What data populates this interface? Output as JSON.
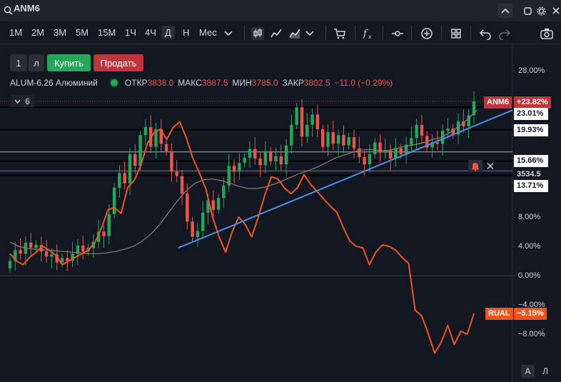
{
  "search": {
    "ticker": "ANM6"
  },
  "toolbar": {
    "timeframes": [
      "1M",
      "2M",
      "3M",
      "5M",
      "15M",
      "1Ч",
      "4Ч",
      "Д",
      "Н",
      "Мес"
    ],
    "active_timeframe": "Д"
  },
  "trade": {
    "qty": "1",
    "lot": "л",
    "buy_label": "Купить",
    "sell_label": "Продать"
  },
  "instrument": {
    "name": "ALUM-6.26 Алюминий",
    "open_label": "ОТКР",
    "open": "3838.0",
    "high_label": "МАКС",
    "high": "3887.5",
    "low_label": "МИН",
    "low": "3785.0",
    "close_label": "ЗАКР",
    "close": "3802.5",
    "change": "−11.0 (−0.29%)"
  },
  "indicator_count": "6",
  "price_tags": {
    "anm6_name": "ANM6",
    "anm6_pct": "+23.82%",
    "rual_name": "RUAL",
    "rual_pct": "−5.15%",
    "current_price": "3534.5"
  },
  "level_tags": [
    "23.01%",
    "19.93%",
    "15.66%",
    "13.71%"
  ],
  "scale_buttons": {
    "auto": "A",
    "log": "Л"
  },
  "colors": {
    "up": "#26a65b",
    "down": "#ef5350",
    "compare": "#f0541e",
    "trendline": "#4a8fe8",
    "ma": "#8b8270"
  },
  "chart_data": {
    "type": "line",
    "yaxis": {
      "unit": "%",
      "ticks": [
        28,
        24,
        20,
        16,
        12,
        8,
        4,
        0,
        -4,
        -8
      ],
      "labels": [
        "28.00%",
        "",
        "",
        "",
        "",
        "8.00%",
        "4.00%",
        "0.00%",
        "−4.00%",
        "−8.00%"
      ],
      "ylim": [
        -10.5,
        30
      ]
    },
    "levels": [
      23.01,
      19.93,
      15.66,
      13.71
    ],
    "series": [
      {
        "name": "ANM6",
        "type": "candles",
        "last": 23.82,
        "closes": [
          2,
          3.5,
          3,
          4.5,
          3.8,
          4.2,
          3.3,
          2.6,
          2.9,
          1.8,
          2.4,
          2.0,
          3.0,
          4.1,
          3.3,
          3.8,
          4.6,
          6.0,
          5.4,
          8.4,
          12.0,
          14.0,
          12.6,
          16.6,
          15.0,
          19.2,
          20.3,
          17.6,
          20.0,
          18.0,
          17.0,
          14.2,
          13.6,
          11.2,
          7.4,
          5.3,
          6.1,
          8.6,
          10.3,
          9.0,
          10.6,
          12.3,
          15.0,
          14.2,
          15.4,
          16.1,
          17.3,
          16.0,
          15.1,
          17.0,
          15.6,
          16.3,
          15.2,
          17.8,
          20.6,
          23.0,
          19.0,
          20.6,
          22.0,
          20.0,
          17.6,
          19.6,
          18.0,
          19.2,
          17.8,
          18.9,
          17.4,
          16.2,
          15.2,
          16.6,
          18.2,
          16.8,
          17.1,
          16.0,
          17.4,
          16.6,
          17.9,
          18.8,
          20.6,
          19.1,
          17.5,
          18.2,
          18.0,
          19.8,
          20.1,
          19.3,
          21.1,
          20.4,
          21.9,
          23.82
        ]
      },
      {
        "name": "MA",
        "type": "line",
        "values": [
          4.6,
          4.0,
          3.7,
          3.6,
          3.5,
          3.4,
          3.3,
          3.2,
          3.1,
          3.0,
          3.0,
          3.1,
          3.3,
          3.6,
          4.0,
          4.7,
          5.7,
          7.0,
          8.6,
          10.2,
          11.6,
          12.6,
          13.1,
          13.2,
          13.0,
          12.6,
          12.2,
          11.9,
          11.9,
          12.1,
          12.5,
          13.0,
          13.5,
          14.0,
          14.4,
          14.9,
          15.5,
          16.1,
          16.5,
          16.9,
          17.2,
          17.2,
          17.1,
          17.1,
          17.4,
          17.7,
          17.9,
          18.2,
          18.6,
          18.9,
          19.6,
          20.4,
          21.4,
          22.6
        ]
      },
      {
        "name": "RUAL",
        "type": "line",
        "last": -5.15,
        "values": [
          3.0,
          2.0,
          1.5,
          2.5,
          3.2,
          4.0,
          3.5,
          2.8,
          1.5,
          2.0,
          2.5,
          3.0,
          3.5,
          4.5,
          6.5,
          9.0,
          9.3,
          8.5,
          12.0,
          13.0,
          15.0,
          18.0,
          19.5,
          20.0,
          18.6,
          20.3,
          21.0,
          18.8,
          16.0,
          14.0,
          11.8,
          8.0,
          5.3,
          3.2,
          6.0,
          8.0,
          7.0,
          5.3,
          8.0,
          11.0,
          13.5,
          13.2,
          12.0,
          11.2,
          12.0,
          13.8,
          12.5,
          11.5,
          10.5,
          9.5,
          8.7,
          6.6,
          4.7,
          4.0,
          3.8,
          1.5,
          3.2,
          4.2,
          4.0,
          3.5,
          2.5,
          1.7,
          -4.7,
          -5.5,
          -7.9,
          -10.6,
          -9.1,
          -6.8,
          -9.4,
          -7.6,
          -8.0,
          -5.15
        ]
      },
      {
        "name": "trendline",
        "type": "line",
        "from": [
          3.8
        ],
        "to": [
          22.6
        ]
      }
    ]
  }
}
